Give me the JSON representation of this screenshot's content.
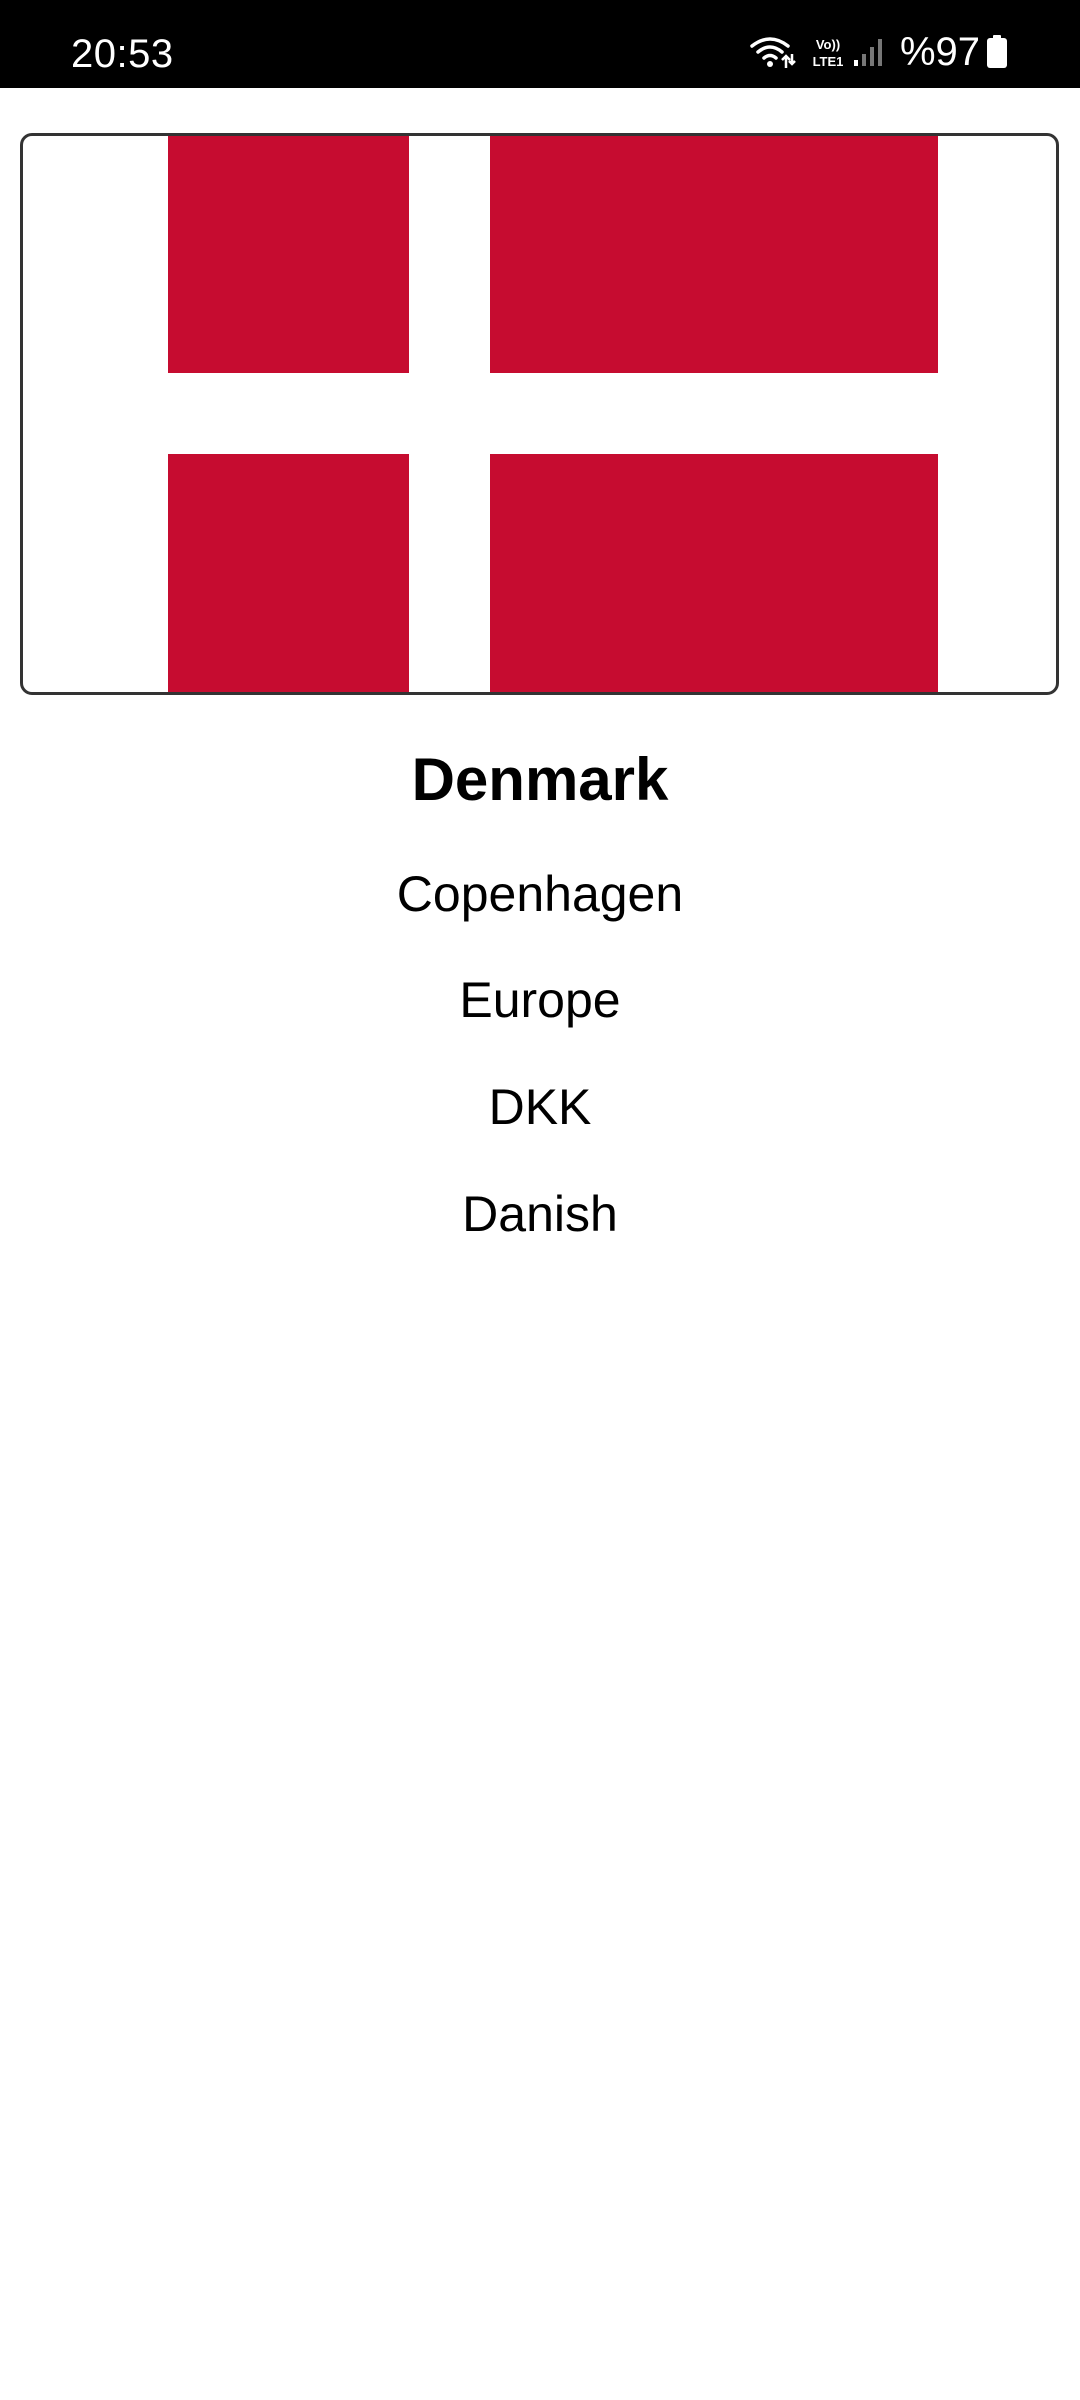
{
  "status_bar": {
    "time": "20:53",
    "network_label": "Vo)) LTE1",
    "battery": "%97",
    "icons": [
      "wifi-icon",
      "volte-lte-icon",
      "signal-icon",
      "battery-icon"
    ]
  },
  "flag": {
    "icon": "denmark-flag",
    "colors": {
      "red": "#C60C30",
      "cross": "#FFFFFF"
    }
  },
  "country": {
    "name": "Denmark",
    "capital": "Copenhagen",
    "region": "Europe",
    "currency": "DKK",
    "language": "Danish"
  }
}
